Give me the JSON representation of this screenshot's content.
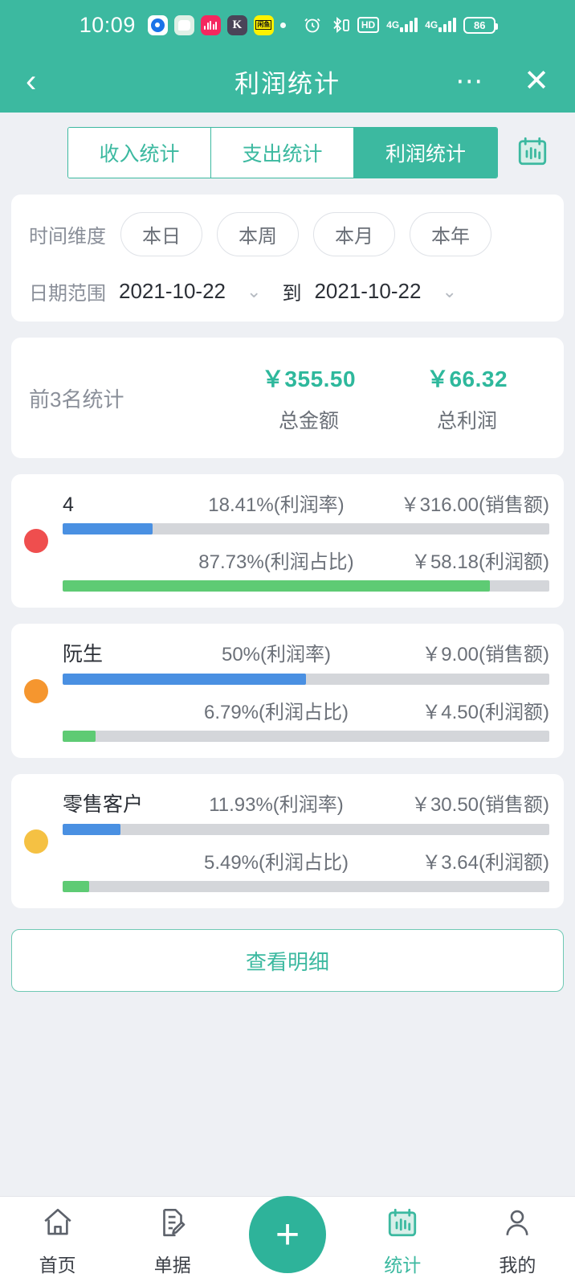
{
  "status_bar": {
    "time": "10:09",
    "battery_level": "86",
    "app_icons": [
      "app-icon-blue-circle",
      "app-icon-white-chat",
      "app-icon-pink-music",
      "app-icon-kuaishou",
      "app-icon-xianyu"
    ],
    "system_icons": [
      "alarm-icon",
      "bluetooth-icon",
      "hd-volte-icon",
      "signal-4g-icon",
      "signal-4g-data-icon",
      "battery-icon"
    ],
    "network_label_1": "4G",
    "network_label_2": "4G",
    "hd_label": "HD"
  },
  "header": {
    "title": "利润统计",
    "back_icon": "chevron-left-icon",
    "more_icon": "more-dots-icon",
    "close_icon": "close-icon"
  },
  "tabs": {
    "items": [
      {
        "label": "收入统计",
        "active": false
      },
      {
        "label": "支出统计",
        "active": false
      },
      {
        "label": "利润统计",
        "active": true
      }
    ],
    "chart_icon": "calendar-chart-icon"
  },
  "filters": {
    "time_dimension_label": "时间维度",
    "time_options": [
      {
        "label": "本日",
        "active": false
      },
      {
        "label": "本周",
        "active": false
      },
      {
        "label": "本月",
        "active": false
      },
      {
        "label": "本年",
        "active": false
      }
    ],
    "date_range_label": "日期范围",
    "date_from": "2021-10-22",
    "date_to": "2021-10-22",
    "to_word": "到",
    "chevron_icon": "chevron-down-icon"
  },
  "summary": {
    "label": "前3名统计",
    "total_amount": {
      "value": "￥355.50",
      "caption": "总金额"
    },
    "total_profit": {
      "value": "￥66.32",
      "caption": "总利润"
    }
  },
  "ranking": {
    "rows": [
      {
        "name": "4",
        "dot_color": "#ef4e4e",
        "profit_rate_text": "18.41%(利润率)",
        "profit_rate_pct": 18.41,
        "sales_text": "￥316.00(销售额)",
        "profit_share_text": "87.73%(利润占比)",
        "profit_share_pct": 87.73,
        "profit_text": "￥58.18(利润额)"
      },
      {
        "name": "阮生",
        "dot_color": "#f5962f",
        "profit_rate_text": "50%(利润率)",
        "profit_rate_pct": 50,
        "sales_text": "￥9.00(销售额)",
        "profit_share_text": "6.79%(利润占比)",
        "profit_share_pct": 6.79,
        "profit_text": "￥4.50(利润额)"
      },
      {
        "name": "零售客户",
        "dot_color": "#f5c143",
        "profit_rate_text": "11.93%(利润率)",
        "profit_rate_pct": 11.93,
        "sales_text": "￥30.50(销售额)",
        "profit_share_text": "5.49%(利润占比)",
        "profit_share_pct": 5.49,
        "profit_text": "￥3.64(利润额)"
      }
    ]
  },
  "detail_button": {
    "label": "查看明细"
  },
  "bottom_nav": {
    "items": [
      {
        "label": "首页",
        "icon": "home-icon",
        "active": false
      },
      {
        "label": "单据",
        "icon": "document-edit-icon",
        "active": false
      },
      {
        "label": "统计",
        "icon": "calendar-chart-icon",
        "active": true
      },
      {
        "label": "我的",
        "icon": "person-icon",
        "active": false
      }
    ],
    "fab_icon": "plus-icon"
  },
  "colors": {
    "brand_teal": "#3cb9a0",
    "bar_blue": "#4a90e2",
    "bar_green": "#5ecb74",
    "track_gray": "#d4d6da",
    "page_bg": "#eef0f4"
  }
}
